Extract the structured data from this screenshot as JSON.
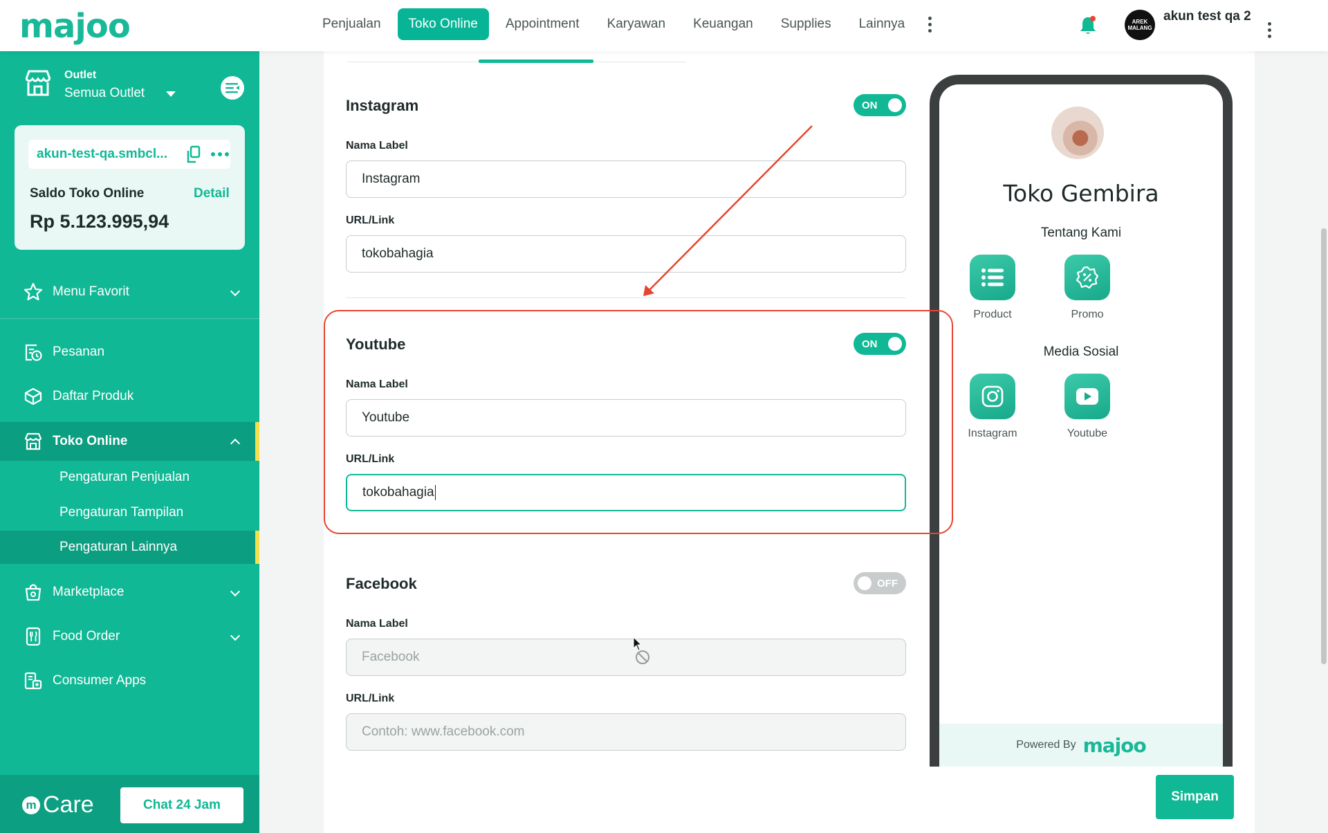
{
  "header": {
    "brand": "majoo",
    "nav": [
      {
        "label": "Penjualan",
        "active": false
      },
      {
        "label": "Toko Online",
        "active": true
      },
      {
        "label": "Appointment",
        "active": false
      },
      {
        "label": "Karyawan",
        "active": false
      },
      {
        "label": "Keuangan",
        "active": false
      },
      {
        "label": "Supplies",
        "active": false
      },
      {
        "label": "Lainnya",
        "active": false
      }
    ],
    "avatar_text": "AREK MALANG",
    "user_name": "akun test qa 2",
    "icons": {
      "notification": "bell-icon",
      "more": "kebab-icon"
    }
  },
  "sidebar": {
    "outlet_label": "Outlet",
    "outlet_value": "Semua Outlet",
    "store_url": "akun-test-qa.smbcl...",
    "saldo_label": "Saldo Toko Online",
    "saldo_detail": "Detail",
    "saldo_value": "Rp 5.123.995,94",
    "menu_favorit": "Menu Favorit",
    "items": [
      {
        "label": "Pesanan"
      },
      {
        "label": "Daftar Produk"
      },
      {
        "label": "Toko Online"
      },
      {
        "label": "Marketplace"
      },
      {
        "label": "Food Order"
      },
      {
        "label": "Consumer Apps"
      }
    ],
    "sub_items": [
      {
        "label": "Pengaturan Penjualan"
      },
      {
        "label": "Pengaturan Tampilan"
      },
      {
        "label": "Pengaturan Lainnya"
      }
    ],
    "care_label": "Care",
    "care_mark": "m",
    "chat_button": "Chat 24 Jam"
  },
  "form": {
    "instagram": {
      "title": "Instagram",
      "toggle": "ON",
      "name_label": "Nama Label",
      "name_value": "Instagram",
      "url_label": "URL/Link",
      "url_value": "tokobahagia"
    },
    "youtube": {
      "title": "Youtube",
      "toggle": "ON",
      "name_label": "Nama Label",
      "name_value": "Youtube",
      "url_label": "URL/Link",
      "url_value": "tokobahagia"
    },
    "facebook": {
      "title": "Facebook",
      "toggle": "OFF",
      "name_label": "Nama Label",
      "name_placeholder": "Facebook",
      "url_label": "URL/Link",
      "url_placeholder": "Contoh: www.facebook.com"
    },
    "save_button": "Simpan"
  },
  "preview": {
    "store_name": "Toko Gembira",
    "about_heading": "Tentang Kami",
    "about_tiles": [
      {
        "label": "Product",
        "icon": "list-icon"
      },
      {
        "label": "Promo",
        "icon": "discount-badge-icon"
      }
    ],
    "social_heading": "Media Sosial",
    "social_tiles": [
      {
        "label": "Instagram",
        "icon": "instagram-icon"
      },
      {
        "label": "Youtube",
        "icon": "youtube-icon"
      }
    ],
    "powered_by": "Powered By",
    "powered_logo": "majoo"
  },
  "colors": {
    "brand": "#10b895",
    "highlight": "#e8442e",
    "active_marker": "#f4e04d"
  }
}
